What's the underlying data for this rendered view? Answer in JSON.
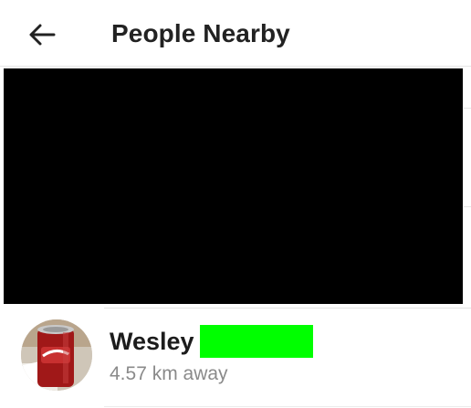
{
  "header": {
    "back_icon": "arrow-left-icon",
    "title": "People Nearby"
  },
  "banner": {
    "redacted": true,
    "color": "#000000"
  },
  "people": [
    {
      "name": "Wesley",
      "name_redaction_color": "#00ff00",
      "distance": "4.57 km away",
      "avatar_icon": "dr-pepper-can-photo"
    }
  ]
}
